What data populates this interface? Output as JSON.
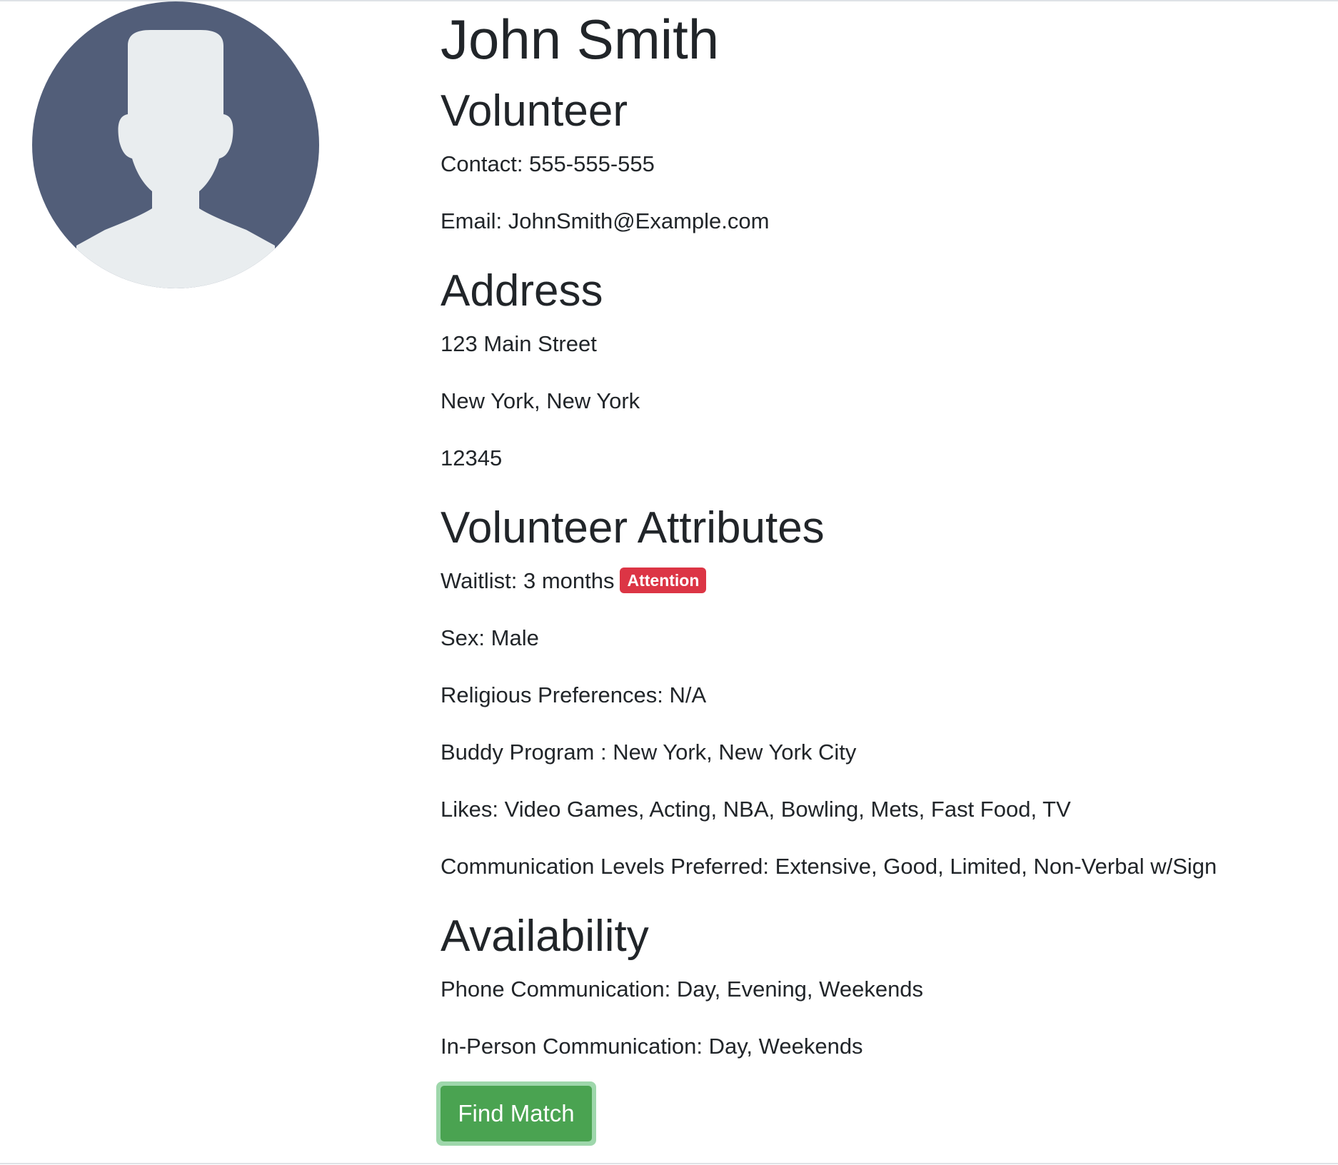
{
  "profile": {
    "name": "John Smith",
    "role": "Volunteer",
    "contact": "Contact: 555-555-555",
    "email": "Email: JohnSmith@Example.com"
  },
  "address": {
    "heading": "Address",
    "street": "123 Main Street",
    "city_state": "New York, New York",
    "zip": "12345"
  },
  "attributes": {
    "heading": "Volunteer Attributes",
    "waitlist": "Waitlist: 3 months",
    "waitlist_badge": "Attention",
    "sex": "Sex: Male",
    "religious": "Religious Preferences: N/A",
    "buddy_program": "Buddy Program : New York, New York City",
    "likes": "Likes: Video Games, Acting, NBA, Bowling, Mets, Fast Food, TV",
    "communication_levels": "Communication Levels Preferred: Extensive, Good, Limited, Non-Verbal w/Sign"
  },
  "availability": {
    "heading": "Availability",
    "phone": "Phone Communication: Day, Evening, Weekends",
    "in_person": "In-Person Communication: Day, Weekends"
  },
  "actions": {
    "find_match_label": "Find Match"
  },
  "icons": {
    "avatar": "default-user-avatar-icon"
  },
  "colors": {
    "avatar_background": "#525e79",
    "avatar_silhouette": "#e9edef",
    "badge_danger": "#dc3545",
    "button_success": "#4aa351",
    "text": "#212529"
  }
}
